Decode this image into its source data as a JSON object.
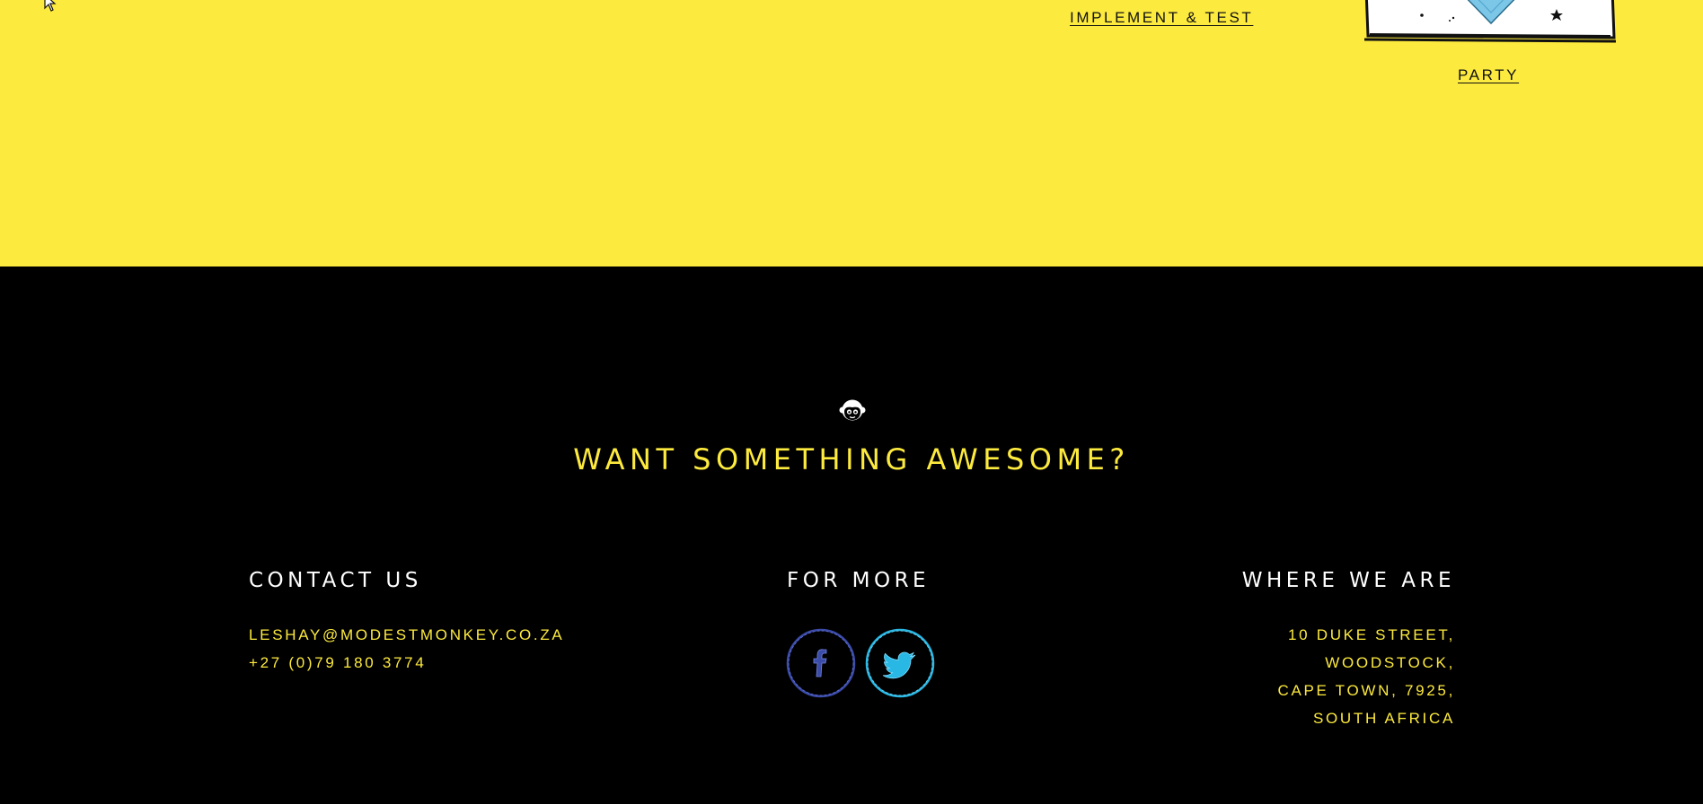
{
  "process": {
    "implement_label": "IMPLEMENT & TEST",
    "party_label": "PARTY"
  },
  "footer": {
    "cta_heading": "WANT SOMETHING AWESOME?",
    "contact": {
      "heading": "CONTACT US",
      "email": "LESHAY@MODESTMONKEY.CO.ZA",
      "phone": "+27 (0)79 180 3774"
    },
    "more": {
      "heading": "FOR MORE",
      "social": [
        {
          "icon": "facebook-icon",
          "color": "#3b4ba8"
        },
        {
          "icon": "twitter-icon",
          "color": "#29b7e4"
        }
      ]
    },
    "where": {
      "heading": "WHERE WE ARE",
      "address_lines": [
        "10 DUKE STREET,",
        "WOODSTOCK,",
        "CAPE TOWN, 7925,",
        "SOUTH AFRICA"
      ]
    }
  },
  "colors": {
    "brand_yellow": "#fdea3e",
    "background": "#000000",
    "heading_white": "#ffffff",
    "facebook_blue": "#3b4ba8",
    "twitter_blue": "#29b7e4"
  }
}
